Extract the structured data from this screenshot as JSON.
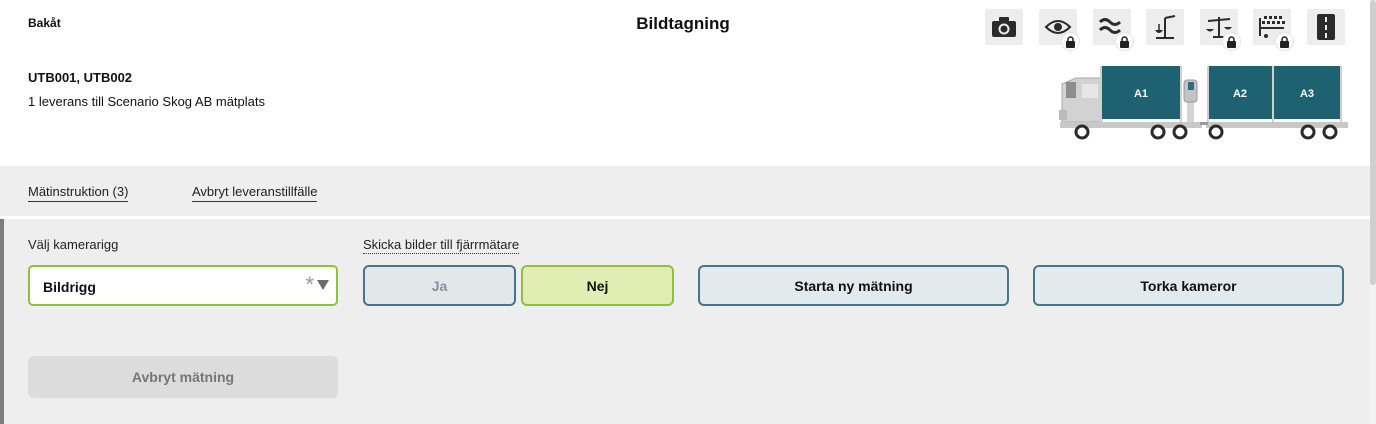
{
  "header": {
    "back_label": "Bakåt",
    "title": "Bildtagning",
    "vehicle_ids": "UTB001, UTB002",
    "delivery_info": "1 leverans till Scenario Skog AB mätplats"
  },
  "toolbar": {
    "icons": [
      "camera-icon",
      "eye-locked-icon",
      "waves-locked-icon",
      "crane-scale-icon",
      "balance-scale-locked-icon",
      "sawing-locked-icon",
      "road-icon"
    ]
  },
  "truck": {
    "compartments": [
      "A1",
      "A2",
      "A3"
    ],
    "load_color": "#1e6170"
  },
  "tabs": {
    "instructions": "Mätinstruktion (3)",
    "cancel_delivery": "Avbryt leveranstillfälle"
  },
  "form": {
    "camera_rig_label": "Välj kamerarigg",
    "camera_rig_value": "Bildrigg",
    "required_mark": "*",
    "send_images_label": "Skicka bilder till fjärrmätare",
    "yes_label": "Ja",
    "no_label": "Nej",
    "start_label": "Starta ny mätning",
    "dry_label": "Torka kameror",
    "cancel_label": "Avbryt mätning"
  },
  "colors": {
    "accent_green": "#8dc23d",
    "accent_teal": "#437689",
    "selected_bg": "#e1edb2"
  }
}
